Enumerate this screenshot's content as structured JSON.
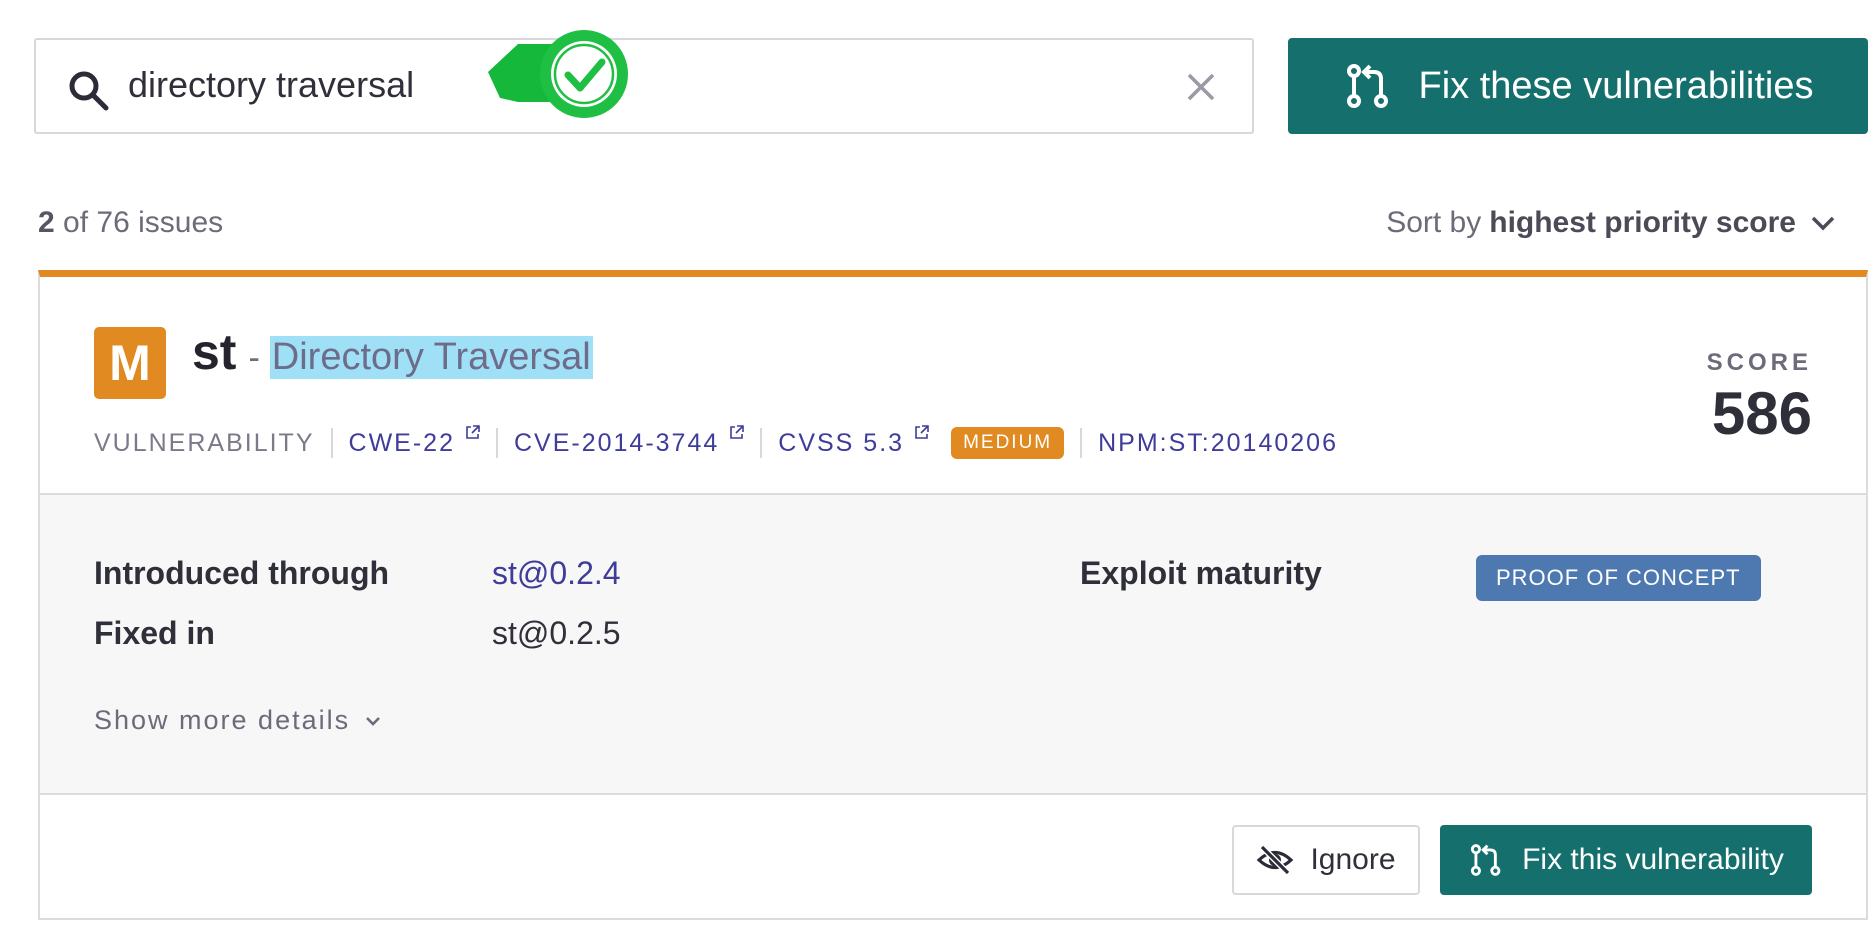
{
  "search": {
    "value": "directory traversal",
    "search_icon": "search-icon",
    "clear_icon": "close-icon",
    "match_icon": "check-circle-icon"
  },
  "actions": {
    "fix_all_label": "Fix these vulnerabilities",
    "fix_icon": "pull-request-icon"
  },
  "results": {
    "shown": "2",
    "summary": "of 76 issues",
    "sort_prefix": "Sort by",
    "sort_value": "highest priority score"
  },
  "issue": {
    "severity_letter": "M",
    "package": "st",
    "separator": "-",
    "title": "Directory Traversal",
    "type": "VULNERABILITY",
    "cwe": "CWE-22",
    "cve": "CVE-2014-3744",
    "cvss": "CVSS 5.3",
    "severity": "MEDIUM",
    "id": "NPM:ST:20140206",
    "score_label": "SCORE",
    "score": "586",
    "introduced_label": "Introduced through",
    "introduced_value": "st@0.2.4",
    "fixed_label": "Fixed in",
    "fixed_value": "st@0.2.5",
    "exploit_label": "Exploit maturity",
    "exploit_value": "PROOF OF CONCEPT",
    "show_more": "Show more details",
    "ignore_label": "Ignore",
    "fix_label": "Fix this vulnerability"
  },
  "colors": {
    "accent_teal": "#146f6d",
    "severity_medium": "#e08a21",
    "link": "#3f3c9a",
    "exploit_pill": "#4e78b0",
    "match_green": "#1fbf44",
    "highlight": "#9fe0f6"
  }
}
